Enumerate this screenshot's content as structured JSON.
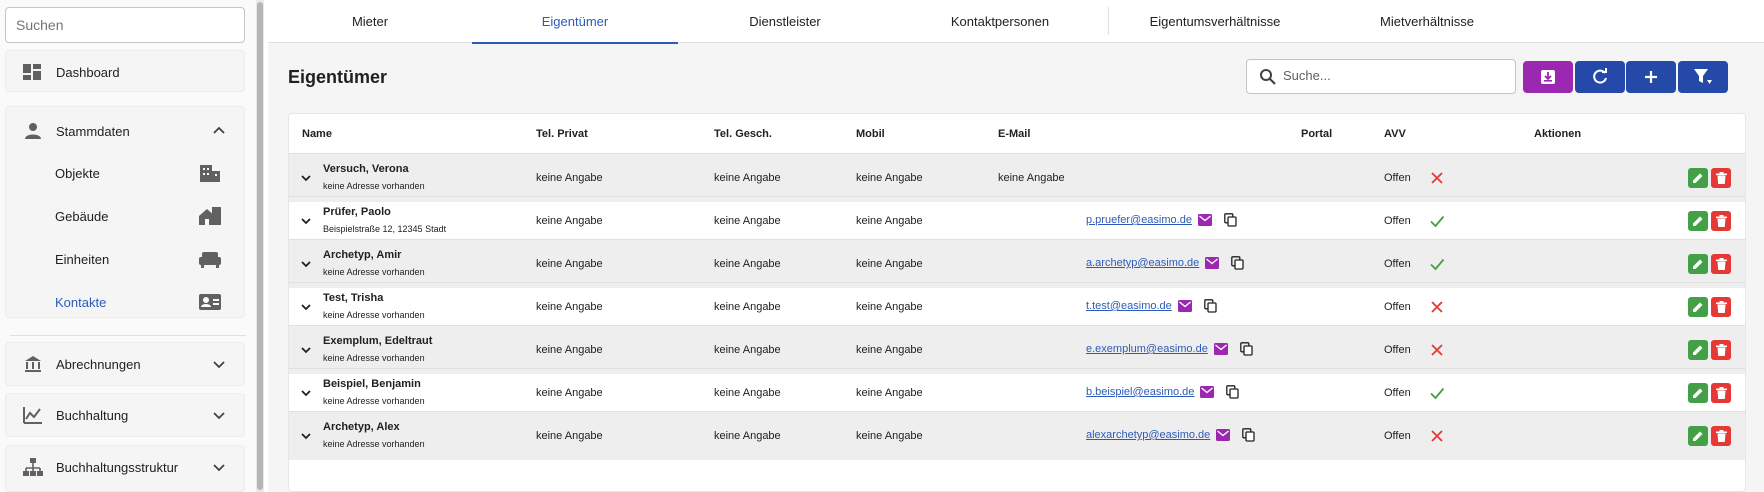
{
  "sidebar": {
    "search_placeholder": "Suchen",
    "dashboard": "Dashboard",
    "stammdaten": "Stammdaten",
    "sub_items": [
      "Objekte",
      "Gebäude",
      "Einheiten",
      "Kontakte"
    ],
    "abrechnungen": "Abrechnungen",
    "buchhaltung": "Buchhaltung",
    "buchhaltungsstruktur": "Buchhaltungsstruktur"
  },
  "tabs": [
    "Mieter",
    "Eigentümer",
    "Dienstleister",
    "Kontaktpersonen",
    "Eigentumsverhältnisse",
    "Mietverhältnisse"
  ],
  "active_tab": "Eigentümer",
  "page_title": "Eigentümer",
  "search_placeholder": "Suche...",
  "colors": {
    "accent": "#2e5bb8",
    "export": "#9c27b0",
    "toolbar": "#2549a8",
    "ok": "#43a047",
    "error": "#e53935"
  },
  "table": {
    "headers": [
      "Name",
      "Tel. Privat",
      "Tel. Gesch.",
      "Mobil",
      "E-Mail",
      "Portal",
      "AVV",
      "Aktionen"
    ],
    "rows": [
      {
        "name": "Versuch, Verona",
        "address": "keine Adresse vorhanden",
        "tel_privat": "keine Angabe",
        "tel_gesch": "keine Angabe",
        "mobil": "keine Angabe",
        "email": "keine Angabe",
        "email_is_link": false,
        "portal": "no",
        "avv": "Offen"
      },
      {
        "name": "Prüfer, Paolo",
        "address": "Beispielstraße 12, 12345 Stadt",
        "tel_privat": "keine Angabe",
        "tel_gesch": "keine Angabe",
        "mobil": "keine Angabe",
        "email": "p.pruefer@easimo.de",
        "email_is_link": true,
        "portal": "yes",
        "avv": "Offen"
      },
      {
        "name": "Archetyp, Amir",
        "address": "keine Adresse vorhanden",
        "tel_privat": "keine Angabe",
        "tel_gesch": "keine Angabe",
        "mobil": "keine Angabe",
        "email": "a.archetyp@easimo.de",
        "email_is_link": true,
        "portal": "yes",
        "avv": "Offen"
      },
      {
        "name": "Test, Trisha",
        "address": "keine Adresse vorhanden",
        "tel_privat": "keine Angabe",
        "tel_gesch": "keine Angabe",
        "mobil": "keine Angabe",
        "email": "t.test@easimo.de",
        "email_is_link": true,
        "portal": "no",
        "avv": "Offen"
      },
      {
        "name": "Exemplum, Edeltraut",
        "address": "keine Adresse vorhanden",
        "tel_privat": "keine Angabe",
        "tel_gesch": "keine Angabe",
        "mobil": "keine Angabe",
        "email": "e.exemplum@easimo.de",
        "email_is_link": true,
        "portal": "no",
        "avv": "Offen"
      },
      {
        "name": "Beispiel, Benjamin",
        "address": "keine Adresse vorhanden",
        "tel_privat": "keine Angabe",
        "tel_gesch": "keine Angabe",
        "mobil": "keine Angabe",
        "email": "b.beispiel@easimo.de",
        "email_is_link": true,
        "portal": "yes",
        "avv": "Offen"
      },
      {
        "name": "Archetyp, Alex",
        "address": "keine Adresse vorhanden",
        "tel_privat": "keine Angabe",
        "tel_gesch": "keine Angabe",
        "mobil": "keine Angabe",
        "email": "alexarchetyp@easimo.de",
        "email_is_link": true,
        "portal": "no",
        "avv": "Offen"
      }
    ]
  }
}
